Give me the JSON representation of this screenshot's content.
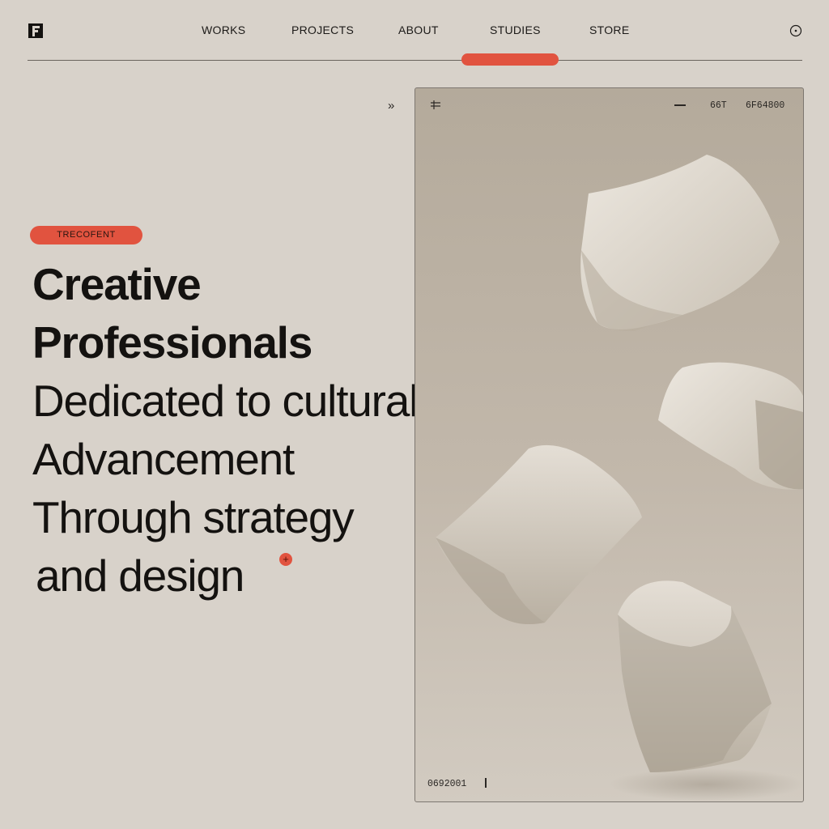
{
  "nav": {
    "items": [
      "WORKS",
      "PROJECTS",
      "ABOUT",
      "STUDIES",
      "STORE"
    ],
    "active_index": 3,
    "accent_color": "#e1533f"
  },
  "icons": {
    "logo": "brand-logo-icon",
    "clock": "clock-icon",
    "expand": "double-chevron-right-icon",
    "panel_menu": "menu-icon",
    "panel_dash": "minus-icon"
  },
  "hero": {
    "tag": "TRECOFENT",
    "lines": [
      "Creative",
      "Professionals",
      "Dedicated to cultural",
      "Advancement",
      "Through strategy",
      "and design"
    ],
    "plus_symbol": "+"
  },
  "panel": {
    "code_1": "66T",
    "code_2": "6F64800",
    "footer_code": "0692001"
  },
  "colors": {
    "background": "#d8d2ca",
    "accent": "#e1533f",
    "text": "#141210"
  }
}
